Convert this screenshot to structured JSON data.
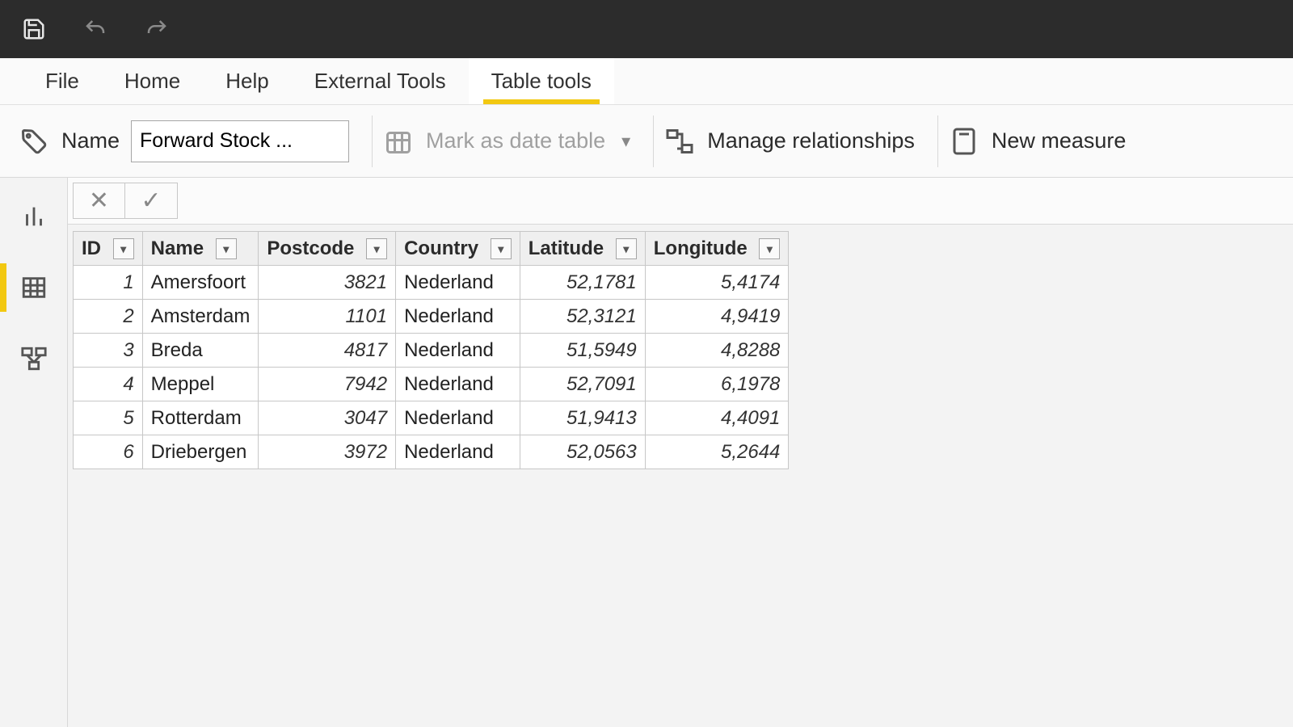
{
  "ribbon": {
    "tabs": [
      "File",
      "Home",
      "Help",
      "External Tools",
      "Table tools"
    ],
    "active_index": 4
  },
  "toolbar": {
    "name_label": "Name",
    "name_value": "Forward Stock ...",
    "mark_date_label": "Mark as date table",
    "manage_rel_label": "Manage relationships",
    "new_measure_label": "New measure"
  },
  "table": {
    "columns": [
      "ID",
      "Name",
      "Postcode",
      "Country",
      "Latitude",
      "Longitude"
    ],
    "rows": [
      {
        "id": "1",
        "name": "Amersfoort",
        "postcode": "3821",
        "country": "Nederland",
        "lat": "52,1781",
        "lon": "5,4174"
      },
      {
        "id": "2",
        "name": "Amsterdam",
        "postcode": "1101",
        "country": "Nederland",
        "lat": "52,3121",
        "lon": "4,9419"
      },
      {
        "id": "3",
        "name": "Breda",
        "postcode": "4817",
        "country": "Nederland",
        "lat": "51,5949",
        "lon": "4,8288"
      },
      {
        "id": "4",
        "name": "Meppel",
        "postcode": "7942",
        "country": "Nederland",
        "lat": "52,7091",
        "lon": "6,1978"
      },
      {
        "id": "5",
        "name": "Rotterdam",
        "postcode": "3047",
        "country": "Nederland",
        "lat": "51,9413",
        "lon": "4,4091"
      },
      {
        "id": "6",
        "name": "Driebergen",
        "postcode": "3972",
        "country": "Nederland",
        "lat": "52,0563",
        "lon": "5,2644"
      }
    ]
  }
}
